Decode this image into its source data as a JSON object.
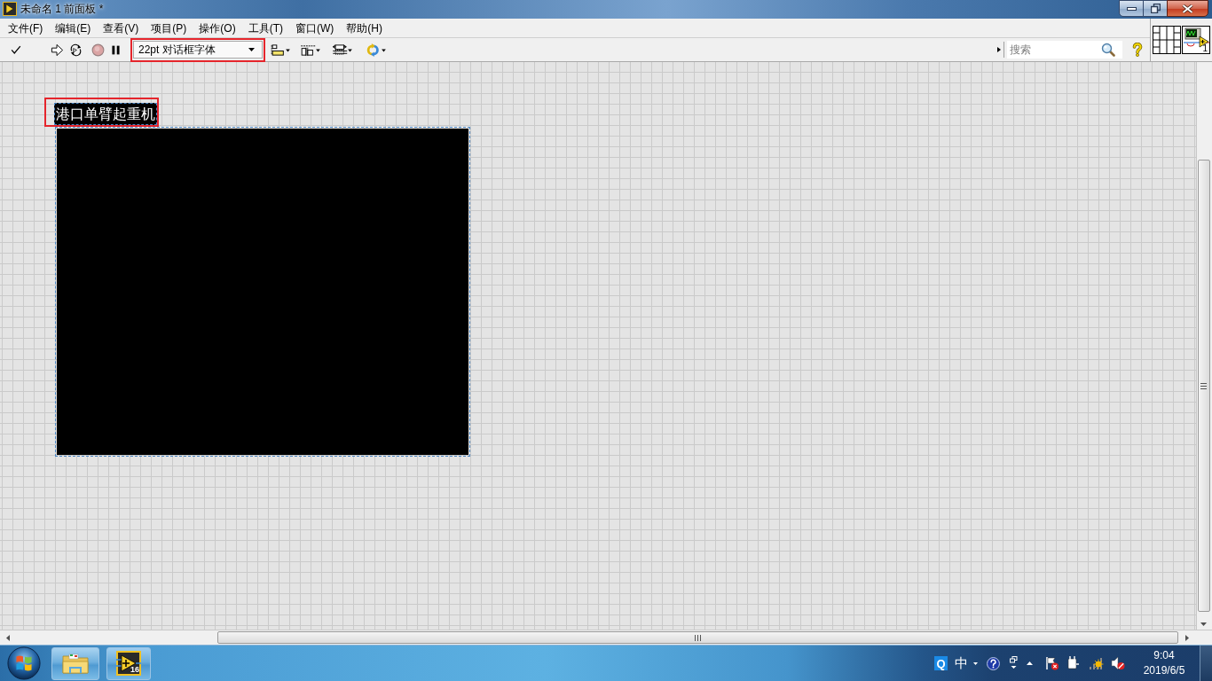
{
  "window": {
    "title": "未命名 1 前面板 *"
  },
  "menu_bar": {
    "items": [
      "文件(F)",
      "编辑(E)",
      "查看(V)",
      "项目(P)",
      "操作(O)",
      "工具(T)",
      "窗口(W)",
      "帮助(H)"
    ]
  },
  "toolbar": {
    "font_select": {
      "value": "22pt 对话框字体",
      "highlighted": true
    },
    "search": {
      "placeholder": "搜索"
    }
  },
  "icon_pane": {
    "vi_icon_label": "1"
  },
  "front_panel": {
    "label": {
      "text": "港口单臂起重机",
      "selected": true,
      "highlighted": true
    },
    "picture": {
      "selected": true
    }
  },
  "taskbar": {
    "buttons": [
      {
        "kind": "explorer"
      },
      {
        "kind": "labview",
        "badge": "16"
      }
    ],
    "tray": {
      "app_badge": "Q",
      "input_mode": "中",
      "time": "9:04",
      "date": "2019/6/5"
    }
  }
}
